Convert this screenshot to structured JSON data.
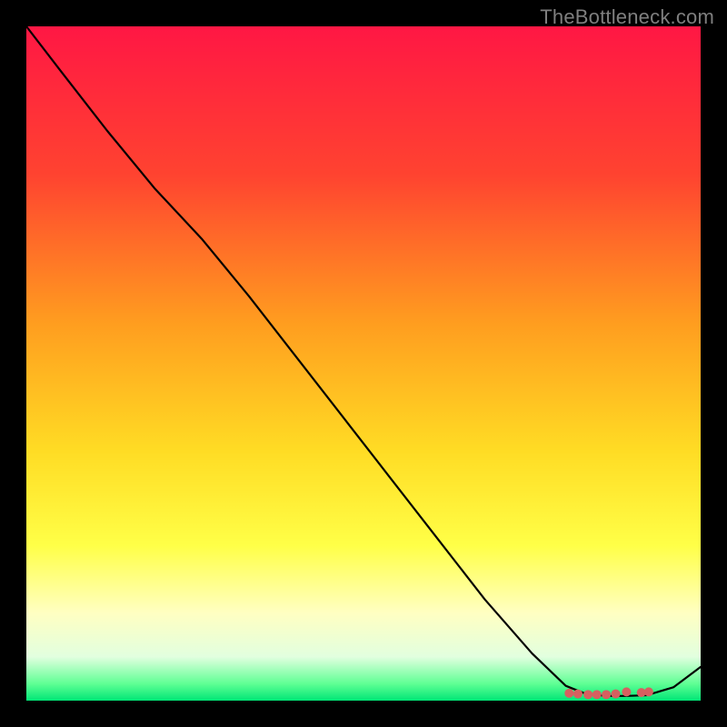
{
  "watermark": "TheBottleneck.com",
  "chart_data": {
    "type": "line",
    "title": "",
    "xlabel": "",
    "ylabel": "",
    "xlim": [
      0,
      100
    ],
    "ylim": [
      0,
      100
    ],
    "grid": false,
    "legend": false,
    "background_gradient": {
      "stops": [
        {
          "offset": 0.0,
          "color": "#ff1744"
        },
        {
          "offset": 0.22,
          "color": "#ff4330"
        },
        {
          "offset": 0.44,
          "color": "#ff9d1f"
        },
        {
          "offset": 0.63,
          "color": "#ffdc24"
        },
        {
          "offset": 0.77,
          "color": "#ffff47"
        },
        {
          "offset": 0.87,
          "color": "#ffffc2"
        },
        {
          "offset": 0.935,
          "color": "#e2ffdf"
        },
        {
          "offset": 0.975,
          "color": "#5fff94"
        },
        {
          "offset": 1.0,
          "color": "#00e676"
        }
      ]
    },
    "series": [
      {
        "name": "curve",
        "color": "#000000",
        "x": [
          0,
          5,
          12,
          19,
          26,
          33,
          40,
          47,
          54,
          61,
          68,
          75,
          80,
          83,
          86,
          89,
          92,
          96,
          100
        ],
        "y": [
          100,
          93.5,
          84.5,
          76.0,
          68.5,
          60.0,
          51.0,
          42.0,
          33.0,
          24.0,
          15.0,
          7.0,
          2.2,
          1.0,
          0.7,
          0.7,
          0.8,
          2.0,
          5.0
        ]
      }
    ],
    "markers": {
      "color": "#d66060",
      "radius_px": 5,
      "points": [
        {
          "x": 80.5,
          "y": 1.1
        },
        {
          "x": 81.8,
          "y": 1.0
        },
        {
          "x": 83.3,
          "y": 0.9
        },
        {
          "x": 84.6,
          "y": 0.9
        },
        {
          "x": 86.0,
          "y": 0.9
        },
        {
          "x": 87.4,
          "y": 1.0
        },
        {
          "x": 89.0,
          "y": 1.3
        },
        {
          "x": 91.2,
          "y": 1.2
        },
        {
          "x": 92.3,
          "y": 1.3
        }
      ]
    }
  }
}
